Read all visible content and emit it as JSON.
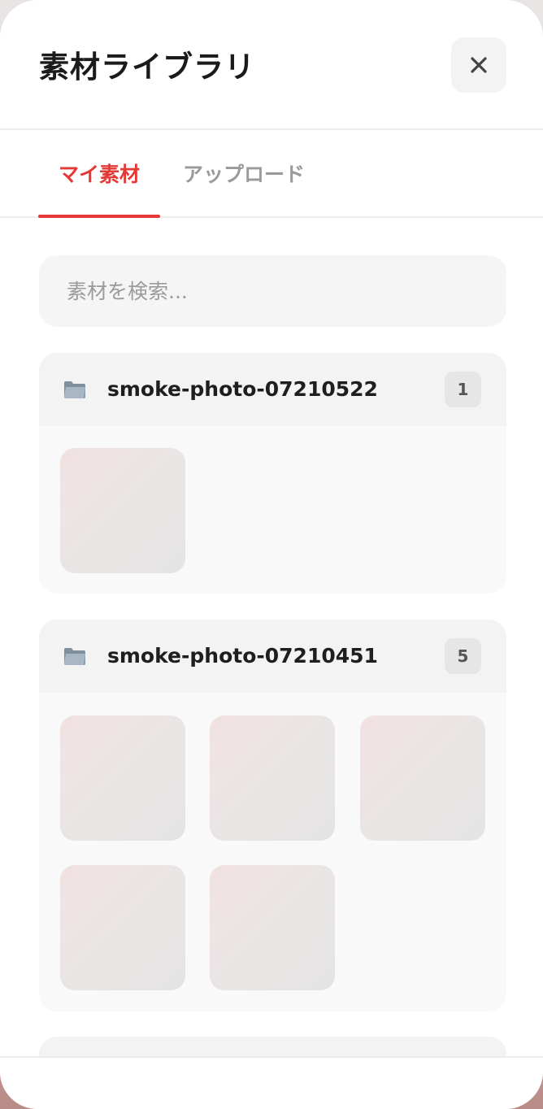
{
  "header": {
    "title": "素材ライブラリ",
    "close_icon": "close-icon"
  },
  "tabs": [
    {
      "label": "マイ素材",
      "active": true
    },
    {
      "label": "アップロード",
      "active": false
    }
  ],
  "search": {
    "placeholder": "素材を検索...",
    "value": ""
  },
  "groups": [
    {
      "name": "smoke-photo-07210522",
      "count": "1",
      "icon": "folder-icon"
    },
    {
      "name": "smoke-photo-07210451",
      "count": "5",
      "icon": "folder-icon"
    }
  ],
  "colors": {
    "accent": "#e53935",
    "inactive_tab": "#9a9a9a"
  }
}
